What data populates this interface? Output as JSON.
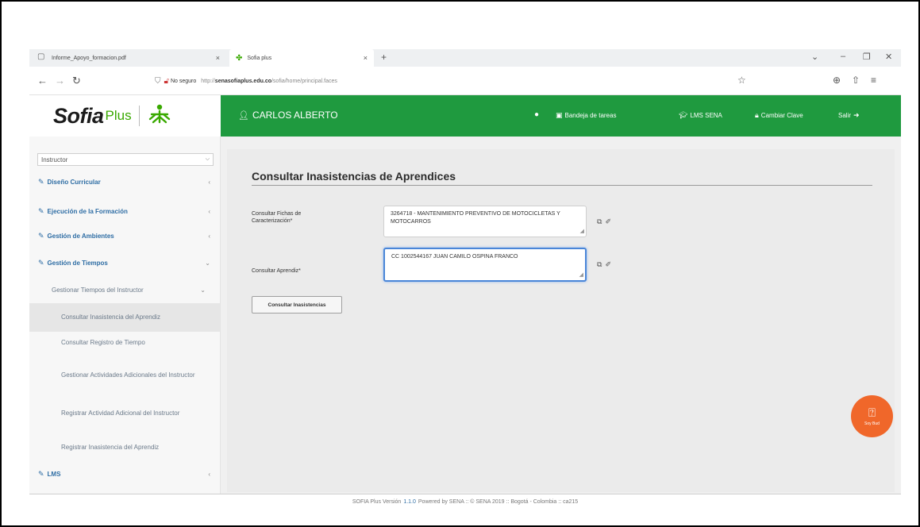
{
  "browser": {
    "tabs": [
      {
        "label": "Informe_Apoyo_formacion.pdf"
      },
      {
        "label": "Sofia plus"
      }
    ],
    "new_tab": "+",
    "url_insecure_label": "No seguro",
    "url_prefix": "http://",
    "url_domain": "senasofiaplus.edu.co",
    "url_path": "/sofia/home/principal.faces"
  },
  "header": {
    "logo_sofia": "Sofia",
    "logo_plus": "Plus",
    "user_name": "CARLOS ALBERTO",
    "nav": [
      {
        "label": "Bandeja de tareas",
        "icon": "inbox-icon"
      },
      {
        "label": "LMS SENA",
        "icon": "graduation-cap-icon"
      },
      {
        "label": "Cambiar Clave",
        "icon": "lock-icon"
      },
      {
        "label": "Salir",
        "icon": "sign-out-icon"
      }
    ],
    "accent_color": "#1f9a3f"
  },
  "sidebar": {
    "role_selected": "Instructor",
    "items": [
      {
        "label": "Diseño Curricular"
      },
      {
        "label": "Ejecución de la Formación"
      },
      {
        "label": "Gestión de Ambientes"
      },
      {
        "label": "Gestión de Tiempos"
      }
    ],
    "submenu": {
      "label": "Gestionar Tiempos del Instructor"
    },
    "leaves": [
      {
        "label": "Consultar Inasistencia del Aprendiz"
      },
      {
        "label": "Consultar Registro de Tiempo"
      },
      {
        "label": "Gestionar Actividades Adicionales del Instructor"
      },
      {
        "label": "Registrar Actividad Adicional del Instructor"
      },
      {
        "label": "Registrar Inasistencia del Aprendiz"
      }
    ],
    "lms": {
      "label": "LMS"
    }
  },
  "main": {
    "title": "Consultar Inasistencias de Aprendices",
    "ficha_label": "Consultar Fichas de Caracterización*",
    "ficha_value": "3264718 - MANTENIMIENTO PREVENTIVO DE MOTOCICLETAS Y MOTOCARROS",
    "aprendiz_label": "Consultar Aprendiz*",
    "aprendiz_value": "CC 1002544167 JUAN CAMILO OSPINA FRANCO",
    "submit_label": "Consultar Inasistencias"
  },
  "floating": {
    "label": "Soy Bud"
  },
  "footer": {
    "prefix": "SOFIA Plus Versión",
    "version": "1.1.0",
    "suffix": "Powered by SENA :: © SENA 2019 :: Bogotá - Colombia :: ca215"
  }
}
